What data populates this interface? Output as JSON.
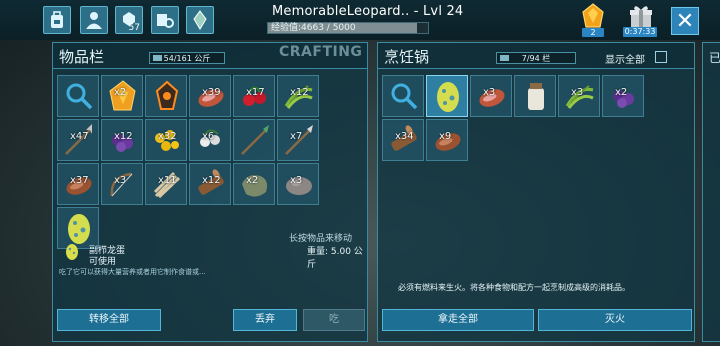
{
  "top_bar": {
    "player_name_level": "MemorableLeopard.. - Lvl 24",
    "xp_text": "经验值:4663 / 5000",
    "xp_progress": 0.93,
    "tab_badge_count": "57",
    "gem_count": "2",
    "gift_timer": "0:37:33",
    "icons": [
      "backpack-icon",
      "character-icon",
      "tribe-icon",
      "map-camera-icon",
      "explorer-notes-icon",
      "element-shard-icon",
      "gift-box-icon",
      "close-icon"
    ]
  },
  "inventory": {
    "title": "物品栏",
    "capacity": "54/161 公斤",
    "crafting_tab": "CRAFTING",
    "slots": [
      {
        "icon": "search-icon",
        "qty": "",
        "selected": false
      },
      {
        "icon": "amber-icon",
        "qty": "x2",
        "selected": false
      },
      {
        "icon": "artifact-icon",
        "qty": "",
        "selected": false
      },
      {
        "icon": "raw-meat-icon",
        "qty": "x39",
        "selected": false
      },
      {
        "icon": "berries-icon",
        "qty": "x17",
        "selected": false
      },
      {
        "icon": "fiber-icon",
        "qty": "x12",
        "selected": false
      },
      {
        "icon": "spear-icon",
        "qty": "x47",
        "selected": false
      },
      {
        "icon": "narcoberry-icon",
        "qty": "x12",
        "selected": false
      },
      {
        "icon": "seeds-icon",
        "qty": "x32",
        "selected": false
      },
      {
        "icon": "mushroom-seeds-icon",
        "qty": "x6",
        "selected": false
      },
      {
        "icon": "green-spear-icon",
        "qty": "",
        "selected": false
      },
      {
        "icon": "pike-icon",
        "qty": "x7",
        "selected": false
      },
      {
        "icon": "cooked-meat-icon",
        "qty": "x37",
        "selected": false
      },
      {
        "icon": "bow-icon",
        "qty": "x3",
        "selected": false
      },
      {
        "icon": "thatch-icon",
        "qty": "x11",
        "selected": false
      },
      {
        "icon": "wood-icon",
        "qty": "x12",
        "selected": false
      },
      {
        "icon": "hide-icon",
        "qty": "x2",
        "selected": false
      },
      {
        "icon": "stone-icon",
        "qty": "x3",
        "selected": false
      },
      {
        "icon": "dodo-egg-icon",
        "qty": "",
        "selected": false
      }
    ],
    "selected_item_name": "副栉龙蛋",
    "selected_item_sub": "可使用",
    "selected_item_desc": "吃了它可以获得大量营养或者用它制作食谱或...",
    "hold_hint": "长按物品来移动",
    "weight": "重量: 5.00 公斤",
    "transfer_all": "转移全部",
    "drop": "丢弃",
    "eat": "吃"
  },
  "cooking_pot": {
    "title": "烹饪锅",
    "capacity": "7/94 栏",
    "show_all": "显示全部",
    "slots": [
      {
        "icon": "search-icon",
        "qty": "",
        "selected": false
      },
      {
        "icon": "egg-icon",
        "qty": "",
        "selected": true
      },
      {
        "icon": "meat-icon",
        "qty": "x3",
        "selected": false
      },
      {
        "icon": "water-jar-icon",
        "qty": "",
        "selected": false
      },
      {
        "icon": "fiber-icon",
        "qty": "x3",
        "selected": false
      },
      {
        "icon": "narcoberry-icon",
        "qty": "x2",
        "selected": false
      },
      {
        "icon": "wood-icon",
        "qty": "x34",
        "selected": false
      },
      {
        "icon": "cooked-meat-icon",
        "qty": "x9",
        "selected": false
      }
    ],
    "fuel_message": "必须有燃料来生火。将各种食物和配方一起烹制成高级的消耗品。",
    "take_all": "拿走全部",
    "extinguish": "灭火"
  },
  "edge_panel_char": "已",
  "colors": {
    "panel_bg": "#123642",
    "accent": "#3c8aa1",
    "button": "#1e6f94",
    "durability": "#4cc5ea"
  }
}
